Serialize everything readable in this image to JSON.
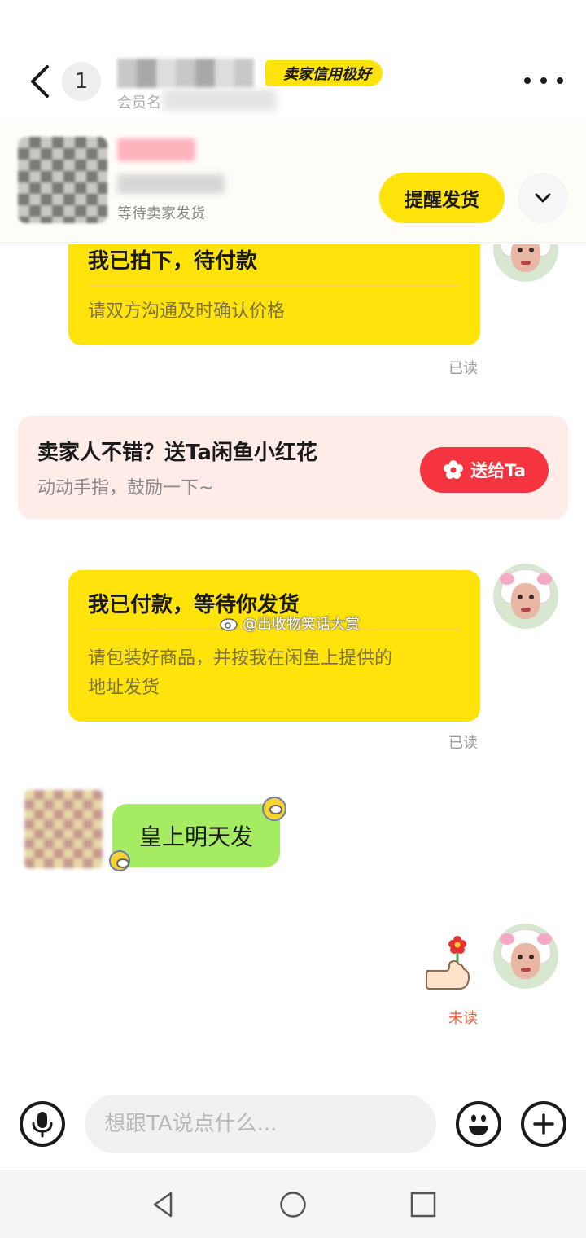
{
  "header": {
    "unread_count": "1",
    "seller_badge": "卖家信用极好",
    "member_prefix": "会员名"
  },
  "product": {
    "status": "等待卖家发货",
    "remind_label": "提醒发货"
  },
  "messages": [
    {
      "title": "我已拍下，待付款",
      "body": "请双方沟通及时确认价格",
      "read": "已读"
    },
    {
      "title": "我已付款，等待你发货",
      "body_line1": "请包装好商品，并按我在闲鱼上提供的",
      "body_line2": "地址发货",
      "read": "已读"
    }
  ],
  "flower_banner": {
    "title": "卖家人不错？送Ta闲鱼小红花",
    "subtitle": "动动手指，鼓励一下~",
    "button_label": "送给Ta"
  },
  "watermark": "@出收物笑话大赏",
  "other_message": "皇上明天发",
  "sticker_status": "未读",
  "input": {
    "placeholder": "想跟TA说点什么..."
  },
  "colors": {
    "accent_yellow": "#ffe30b",
    "flower_red": "#f53440",
    "bubble_green": "#a6ec63",
    "banner_bg": "#ffece9"
  }
}
